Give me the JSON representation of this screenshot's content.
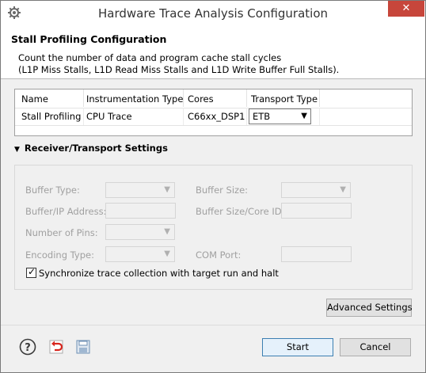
{
  "window": {
    "title": "Hardware Trace Analysis Configuration",
    "close_glyph": "✕"
  },
  "header": {
    "title": "Stall Profiling Configuration",
    "desc_line1": "Count the number of data and program cache stall cycles",
    "desc_line2": "(L1P Miss Stalls, L1D Read Miss Stalls and L1D Write Buffer Full Stalls)."
  },
  "table": {
    "columns": [
      "Name",
      "Instrumentation Type",
      "Cores",
      "Transport Type"
    ],
    "rows": [
      {
        "name": "Stall Profiling",
        "instrumentation": "CPU Trace",
        "cores": "C66xx_DSP1",
        "transport": "ETB"
      }
    ]
  },
  "receiver": {
    "section_title": "Receiver/Transport Settings",
    "buffer_type_label": "Buffer Type:",
    "buffer_size_label": "Buffer Size:",
    "buffer_ip_label": "Buffer/IP Address:",
    "buffer_size_core_label": "Buffer Size/Core ID:",
    "num_pins_label": "Number of Pins:",
    "encoding_label": "Encoding Type:",
    "com_port_label": "COM Port:",
    "sync_label": "Synchronize trace collection with target run and halt",
    "sync_checked": true
  },
  "buttons": {
    "advanced": "Advanced Settings",
    "start": "Start",
    "cancel": "Cancel"
  },
  "icons": {
    "help": "help-icon",
    "restore": "restore-defaults-icon",
    "save": "save-icon"
  }
}
